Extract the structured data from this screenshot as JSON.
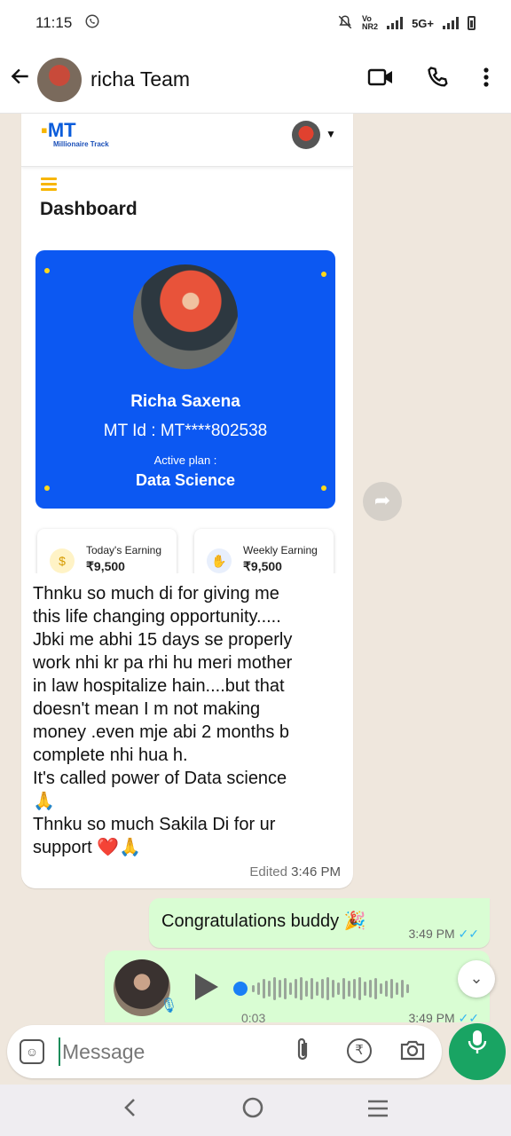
{
  "status_bar": {
    "time": "11:15",
    "network": "5G+"
  },
  "header": {
    "title": "richa Team"
  },
  "screenshot": {
    "logo_text": "MT",
    "logo_sub": "Millionaire Track",
    "page_title": "Dashboard",
    "profile": {
      "name": "Richa Saxena",
      "mt_id": "MT Id :  MT****802538",
      "plan_label": "Active plan :",
      "plan": "Data Science"
    },
    "earnings": [
      {
        "label": "Today's Earning",
        "value": "₹9,500"
      },
      {
        "label": "Weekly Earning",
        "value": "₹9,500"
      }
    ]
  },
  "messages": {
    "incoming": {
      "lines": [
        "Thnku so much di for giving me",
        "this life changing opportunity.....",
        "Jbki me abhi 15 days se properly",
        "work nhi kr pa rhi hu meri mother",
        "in law hospitalize hain....but that",
        "doesn't mean I m not making",
        "money .even mje abi 2 months b",
        "complete nhi hua h.",
        "It's called power of Data science",
        "🙏",
        "Thnku so much Sakila Di for ur",
        "support ❤️🙏"
      ],
      "edited": "Edited",
      "time": "3:46 PM"
    },
    "outgoing": {
      "text": "Congratulations buddy 🎉",
      "time": "3:49 PM"
    },
    "voice": {
      "duration": "0:03",
      "time": "3:49 PM"
    }
  },
  "input": {
    "placeholder": "Message"
  },
  "colors": {
    "accent": "#19a463",
    "card_blue": "#0c58f2",
    "outgoing_bubble": "#d9fdd3"
  }
}
